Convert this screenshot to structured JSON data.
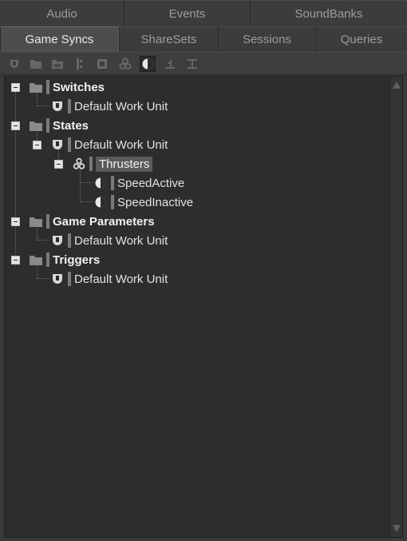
{
  "tabs_row1": [
    {
      "label": "Audio"
    },
    {
      "label": "Events"
    },
    {
      "label": "SoundBanks"
    }
  ],
  "tabs_row2": [
    {
      "label": "Game Syncs",
      "active": true
    },
    {
      "label": "ShareSets"
    },
    {
      "label": "Sessions"
    },
    {
      "label": "Queries"
    }
  ],
  "toolbar": {
    "buttons": [
      {
        "icon": "work-unit-icon"
      },
      {
        "icon": "folder-icon"
      },
      {
        "icon": "virtual-folder-icon"
      },
      {
        "icon": "switch-group-icon"
      },
      {
        "icon": "switch-icon"
      },
      {
        "icon": "state-group-icon"
      },
      {
        "icon": "state-icon",
        "selected": true
      },
      {
        "icon": "game-parameter-icon"
      },
      {
        "icon": "trigger-icon"
      }
    ]
  },
  "tree": {
    "switches": {
      "label": "Switches",
      "child": "Default Work Unit"
    },
    "states": {
      "label": "States",
      "work_unit": "Default Work Unit",
      "group": "Thrusters",
      "items": [
        "SpeedActive",
        "SpeedInactive"
      ]
    },
    "game_parameters": {
      "label": "Game Parameters",
      "child": "Default Work Unit"
    },
    "triggers": {
      "label": "Triggers",
      "child": "Default Work Unit"
    }
  }
}
